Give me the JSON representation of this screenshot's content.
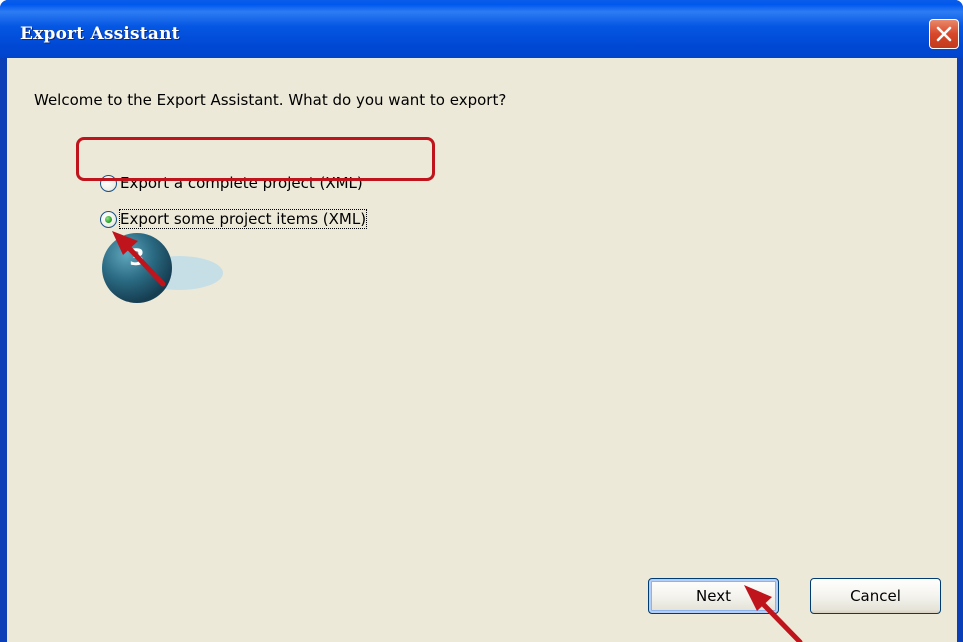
{
  "window": {
    "title": "Export Assistant"
  },
  "prompt": "Welcome to the Export Assistant. What do you want to export?",
  "options": [
    {
      "label": "Export a complete project (XML)",
      "checked": false
    },
    {
      "label": "Export some project items (XML)",
      "checked": true
    }
  ],
  "buttons": {
    "next_label": "Next",
    "cancel_label": "Cancel"
  },
  "annotation": {
    "step_number": "3",
    "highlight_color": "#c0141c",
    "arrow_color": "#c0141c",
    "marker_color": "#2a6a82"
  },
  "icons": {
    "close": "close-icon",
    "radio_unchecked": "radio-unchecked-icon",
    "radio_checked": "radio-checked-icon"
  }
}
